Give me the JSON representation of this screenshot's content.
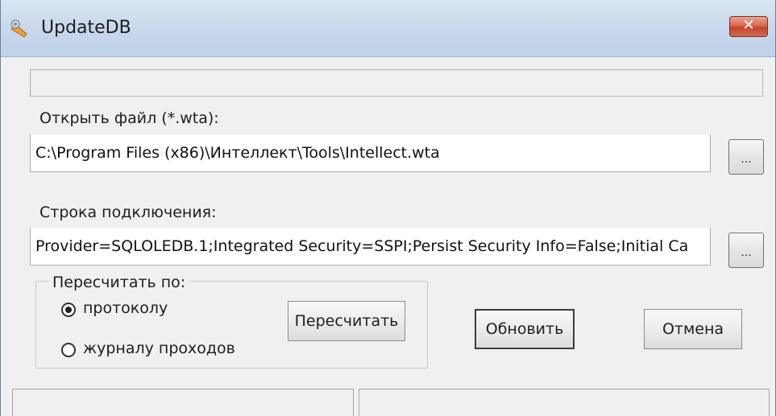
{
  "window": {
    "title": "UpdateDB",
    "icon": "wrench-key-icon",
    "close_label": "✕"
  },
  "progress": {
    "value": 0
  },
  "file": {
    "label": "Открыть файл (*.wta):",
    "value": "C:\\Program Files (x86)\\Интеллект\\Tools\\Intellect.wta",
    "browse_label": "..."
  },
  "connection": {
    "label": "Строка подключения:",
    "value": "Provider=SQLOLEDB.1;Integrated Security=SSPI;Persist Security Info=False;Initial Ca",
    "browse_label": "..."
  },
  "recalc": {
    "legend": "Пересчитать по:",
    "options": [
      {
        "label": "протоколу",
        "checked": true
      },
      {
        "label": "журналу проходов",
        "checked": false
      }
    ],
    "button_label": "Пересчитать"
  },
  "actions": {
    "update_label": "Обновить",
    "cancel_label": "Отмена"
  },
  "statusbar": {
    "panels": [
      "",
      ""
    ]
  }
}
